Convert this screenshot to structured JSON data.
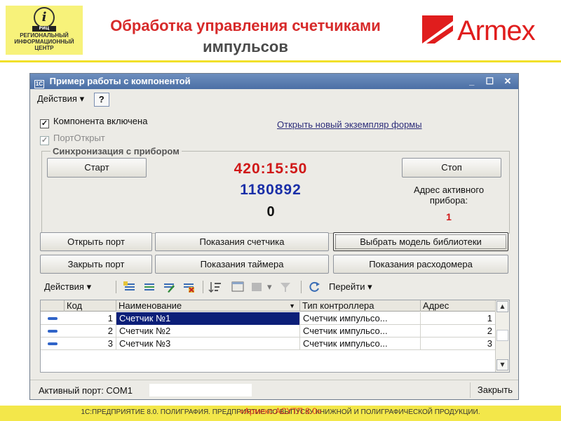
{
  "header": {
    "logo_abbr": "РИЦ",
    "logo_line1": "РЕГИОНАЛЬНЫЙ",
    "logo_line2": "ИНФОРМАЦИОННЫЙ",
    "logo_line3": "ЦЕНТР",
    "title_line1": "Обработка управления счетчиками",
    "title_line2": "импульсов",
    "brand": "Armex",
    "brand_color": "#e01d1d",
    "title_color": "#d72a2a"
  },
  "window": {
    "title": "Пример работы с компонентой",
    "controls": [
      "_",
      "☐",
      "✕"
    ],
    "menu_actions": "Действия",
    "help": "?"
  },
  "options": {
    "component_enabled_label": "Компонента включена",
    "component_enabled_checked": true,
    "port_open_label": "ПортОткрыт",
    "port_open_checked": true,
    "port_open_disabled": true,
    "open_new_form_link": "Открыть новый экземпляр формы"
  },
  "sync": {
    "group_title": "Синхронизация с прибором",
    "start_button": "Старт",
    "stop_button": "Стоп",
    "timer": "420:15:50",
    "counter": "1180892",
    "zero_value": "0",
    "active_device_label": "Адрес активного прибора:",
    "active_device_value": "1",
    "timer_color": "#d01818",
    "counter_color": "#1a2fa8"
  },
  "buttons": {
    "open_port": "Открыть порт",
    "counter_readings": "Показания счетчика",
    "choose_library_model": "Выбрать модель библиотеки",
    "close_port": "Закрыть порт",
    "timer_readings": "Показания таймера",
    "flowmeter_readings": "Показания расходомера"
  },
  "table_toolbar": {
    "actions": "Действия",
    "goto": "Перейти",
    "icons": [
      "add-row-icon",
      "copy-row-icon",
      "edit-row-icon",
      "delete-row-icon",
      "sort-icon",
      "hierarchy-icon",
      "group-icon",
      "filter-icon",
      "refresh-icon"
    ]
  },
  "table": {
    "columns": [
      "Код",
      "Наименование",
      "Тип контроллера",
      "Адрес"
    ],
    "rows": [
      {
        "code": "1",
        "name": "Счетчик №1",
        "type": "Счетчик импульсо...",
        "address": "1",
        "selected": true
      },
      {
        "code": "2",
        "name": "Счетчик №2",
        "type": "Счетчик импульсо...",
        "address": "2",
        "selected": false
      },
      {
        "code": "3",
        "name": "Счетчик №3",
        "type": "Счетчик импульсо...",
        "address": "3",
        "selected": false
      }
    ]
  },
  "status": {
    "active_port": "Активный порт: COM1",
    "close": "Закрыть"
  },
  "footer": {
    "text": "1С:ПРЕДПРИЯТИЕ 8.0. ПОЛИГРАФИЯ. ПРЕДПРИЯТИЕ ПО ВЫПУСКУ КНИЖНОЙ И ПОЛИГРАФИЧЕСКОЙ ПРОДУКЦИИ.",
    "overlay": "«Армекс:АСУТП 8.0»"
  }
}
